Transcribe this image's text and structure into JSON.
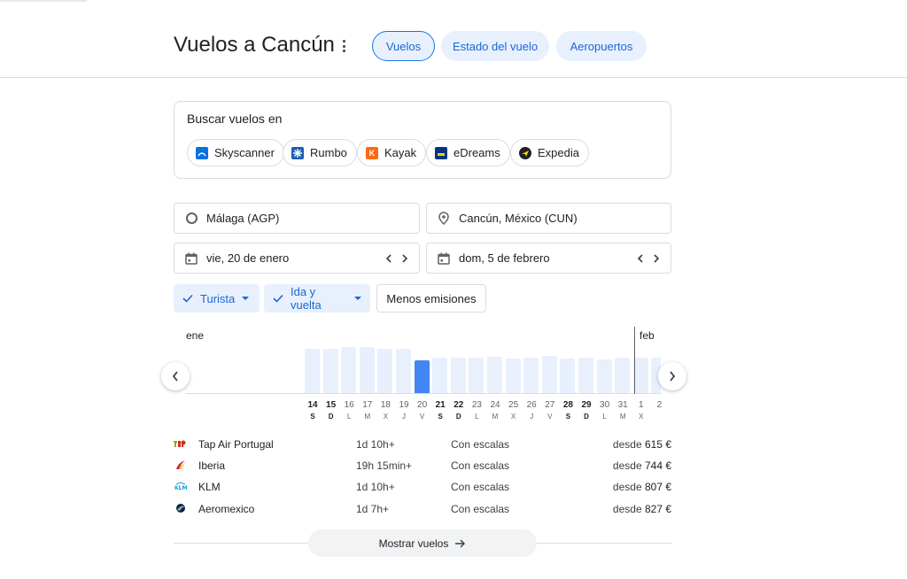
{
  "header": {
    "title": "Vuelos a Cancún",
    "tabs": [
      {
        "label": "Vuelos"
      },
      {
        "label": "Estado del vuelo"
      },
      {
        "label": "Aeropuertos"
      }
    ]
  },
  "search": {
    "title": "Buscar vuelos en",
    "sites": [
      {
        "label": "Skyscanner",
        "icon": "skyscanner-icon",
        "color": "#0770e3"
      },
      {
        "label": "Rumbo",
        "icon": "rumbo-icon",
        "color": "#1a5fb4"
      },
      {
        "label": "Kayak",
        "icon": "kayak-icon",
        "color": "#ff690f"
      },
      {
        "label": "eDreams",
        "icon": "edreams-icon",
        "color": "#003580"
      },
      {
        "label": "Expedia",
        "icon": "expedia-icon",
        "color": "#202124"
      }
    ]
  },
  "form": {
    "origin": "Málaga (AGP)",
    "destination": "Cancún, México (CUN)",
    "depart_date": "vie, 20 de enero",
    "return_date": "dom, 5 de febrero"
  },
  "filters": {
    "cabin": "Turista",
    "trip": "Ida y vuelta",
    "emissions": "Menos emisiones"
  },
  "calendar": {
    "month_start": "ene",
    "month_next": "feb",
    "days": [
      {
        "num": "14",
        "wk": "S",
        "bold": true,
        "level": 0.79,
        "selected": false
      },
      {
        "num": "15",
        "wk": "D",
        "bold": true,
        "level": 0.79,
        "selected": false
      },
      {
        "num": "16",
        "wk": "L",
        "bold": false,
        "level": 0.82,
        "selected": false
      },
      {
        "num": "17",
        "wk": "M",
        "bold": false,
        "level": 0.82,
        "selected": false
      },
      {
        "num": "18",
        "wk": "X",
        "bold": false,
        "level": 0.78,
        "selected": false
      },
      {
        "num": "19",
        "wk": "J",
        "bold": false,
        "level": 0.79,
        "selected": false
      },
      {
        "num": "20",
        "wk": "V",
        "bold": false,
        "level": 0.59,
        "selected": true
      },
      {
        "num": "21",
        "wk": "S",
        "bold": true,
        "level": 0.63,
        "selected": false
      },
      {
        "num": "22",
        "wk": "D",
        "bold": true,
        "level": 0.63,
        "selected": false
      },
      {
        "num": "23",
        "wk": "L",
        "bold": false,
        "level": 0.63,
        "selected": false
      },
      {
        "num": "24",
        "wk": "M",
        "bold": false,
        "level": 0.64,
        "selected": false
      },
      {
        "num": "25",
        "wk": "X",
        "bold": false,
        "level": 0.61,
        "selected": false
      },
      {
        "num": "26",
        "wk": "J",
        "bold": false,
        "level": 0.63,
        "selected": false
      },
      {
        "num": "27",
        "wk": "V",
        "bold": false,
        "level": 0.66,
        "selected": false
      },
      {
        "num": "28",
        "wk": "S",
        "bold": true,
        "level": 0.62,
        "selected": false
      },
      {
        "num": "29",
        "wk": "D",
        "bold": true,
        "level": 0.63,
        "selected": false
      },
      {
        "num": "30",
        "wk": "L",
        "bold": false,
        "level": 0.6,
        "selected": false
      },
      {
        "num": "31",
        "wk": "M",
        "bold": false,
        "level": 0.63,
        "selected": false
      },
      {
        "num": "1",
        "wk": "X",
        "bold": false,
        "level": 0.63,
        "selected": false
      },
      {
        "num": "2",
        "wk": "J",
        "bold": false,
        "level": 0.63,
        "selected": false
      }
    ]
  },
  "results": [
    {
      "airline": "Tap Air Portugal",
      "duration": "1d 10h+",
      "stops": "Con escalas",
      "desde": "desde",
      "price": "615 €",
      "logo": "tap-logo-icon",
      "color": "#d52b1e"
    },
    {
      "airline": "Iberia",
      "duration": "19h 15min+",
      "stops": "Con escalas",
      "desde": "desde",
      "price": "744 €",
      "logo": "iberia-logo-icon",
      "color": "#d7192d"
    },
    {
      "airline": "KLM",
      "duration": "1d 10h+",
      "stops": "Con escalas",
      "desde": "desde",
      "price": "807 €",
      "logo": "klm-logo-icon",
      "color": "#00a1de"
    },
    {
      "airline": "Aeromexico",
      "duration": "1d 7h+",
      "stops": "Con escalas",
      "desde": "desde",
      "price": "827 €",
      "logo": "aeromexico-logo-icon",
      "color": "#0b2343"
    }
  ],
  "show_button": "Mostrar vuelos",
  "colors": {
    "accent": "#1a73e8",
    "chip_bg": "#e8f0fe",
    "bar": "#e8f0fe",
    "bar_selected": "#4285f4"
  }
}
